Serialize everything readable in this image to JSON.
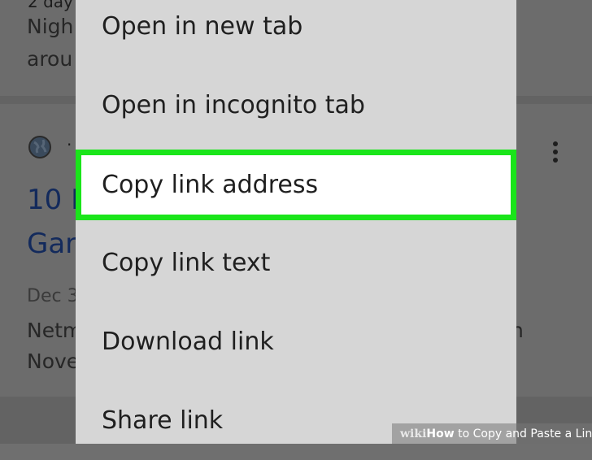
{
  "background": {
    "top_lines": [
      "2 day",
      "Nigh",
      "arou"
    ],
    "result": {
      "site_letter": "·",
      "title_lines": [
        "10 E",
        "Gar"
      ],
      "date": "Dec 3",
      "snippet_lines": [
        "Netm",
        "Nove"
      ],
      "snippet_right": "n"
    }
  },
  "context_menu": {
    "items": [
      {
        "label": "Open in new tab"
      },
      {
        "label": "Open in incognito tab"
      },
      {
        "label": "Copy link address"
      },
      {
        "label": "Copy link text"
      },
      {
        "label": "Download link"
      },
      {
        "label": "Share link"
      }
    ],
    "highlighted_index": 2,
    "highlight_color": "#1ae51a"
  },
  "watermark": {
    "brand": "wiki",
    "bold": "How",
    "text": " to Copy and Paste a Link"
  }
}
